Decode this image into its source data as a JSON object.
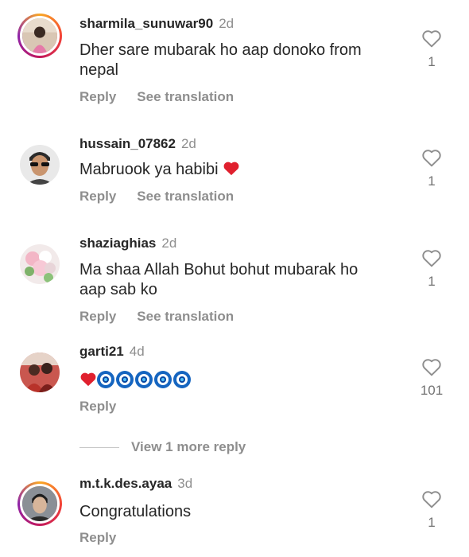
{
  "comments": [
    {
      "username": "sharmila_sunuwar90",
      "time": "2d",
      "text_line1": "Dher sare mubarak ho aap donoko from",
      "text_line2": "nepal",
      "reply": "Reply",
      "translate": "See translation",
      "likes": "1"
    },
    {
      "username": "hussain_07862",
      "time": "2d",
      "text_line1": "Mabruook ya habibi",
      "reply": "Reply",
      "translate": "See translation",
      "likes": "1"
    },
    {
      "username": "shaziaghias",
      "time": "2d",
      "text_line1": "Ma shaa Allah Bohut bohut mubarak ho",
      "text_line2": "aap sab ko",
      "reply": "Reply",
      "translate": "See translation",
      "likes": "1"
    },
    {
      "username": "garti21",
      "time": "4d",
      "reply": "Reply",
      "likes": "101",
      "emojis": [
        "red-heart",
        "nazar-amulet",
        "nazar-amulet",
        "nazar-amulet",
        "nazar-amulet",
        "nazar-amulet"
      ]
    },
    {
      "username": "m.t.k.des.ayaa",
      "time": "3d",
      "text_line1": "Congratulations",
      "reply": "Reply",
      "likes": "1"
    }
  ],
  "view_more": "View 1 more reply",
  "colors": {
    "text": "#262626",
    "muted": "#8e8e8e",
    "heart_emoji": "#e0202e",
    "nazar_blue": "#1565c0"
  }
}
